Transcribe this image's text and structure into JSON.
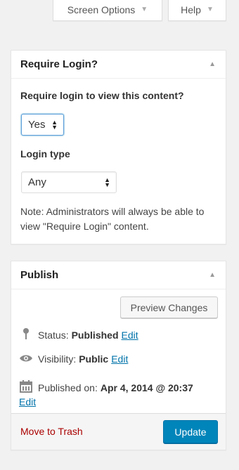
{
  "screen_meta": {
    "screen_options": "Screen Options",
    "help": "Help"
  },
  "require_login_box": {
    "title": "Require Login?",
    "question": "Require login to view this content?",
    "require_select": {
      "selected": "Yes"
    },
    "login_type_label": "Login type",
    "login_type_select": {
      "selected": "Any"
    },
    "note": "Note: Administrators will always be able to view \"Require Login\" content."
  },
  "publish_box": {
    "title": "Publish",
    "preview_button": "Preview Changes",
    "status": {
      "label": "Status:",
      "value": "Published",
      "edit": "Edit",
      "icon": "pin-icon"
    },
    "visibility": {
      "label": "Visibility:",
      "value": "Public",
      "edit": "Edit",
      "icon": "eye-icon"
    },
    "published_on": {
      "label": "Published on:",
      "value": "Apr 4, 2014 @ 20:37",
      "edit": "Edit",
      "icon": "calendar-icon"
    },
    "trash_link": "Move to Trash",
    "update_button": "Update"
  },
  "colors": {
    "primary_button": "#0085ba",
    "link": "#0073aa",
    "trash": "#aa0000",
    "background": "#f1f1f1"
  }
}
